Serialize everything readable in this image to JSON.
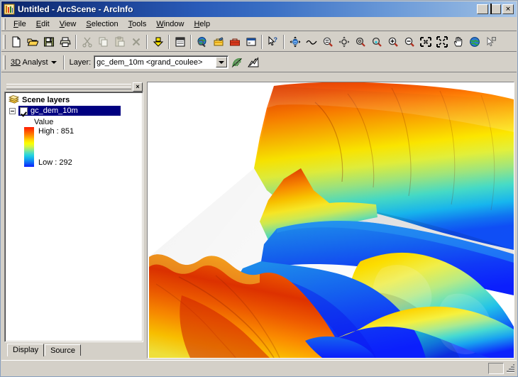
{
  "window": {
    "title": "Untitled - ArcScene - ArcInfo",
    "icon": "arcscene-icon",
    "minimize_label": "_",
    "maximize_label": "□",
    "close_label": "X"
  },
  "menubar": {
    "items": [
      {
        "label": "File",
        "accel": "F"
      },
      {
        "label": "Edit",
        "accel": "E"
      },
      {
        "label": "View",
        "accel": "V"
      },
      {
        "label": "Selection",
        "accel": "S"
      },
      {
        "label": "Tools",
        "accel": "T"
      },
      {
        "label": "Window",
        "accel": "W"
      },
      {
        "label": "Help",
        "accel": "H"
      }
    ]
  },
  "toolbar_standard": {
    "buttons": [
      {
        "name": "new-document-button",
        "icon": "new-document-icon",
        "enabled": true
      },
      {
        "name": "open-button",
        "icon": "open-folder-icon",
        "enabled": true
      },
      {
        "name": "save-button",
        "icon": "save-disk-icon",
        "enabled": true
      },
      {
        "name": "print-button",
        "icon": "printer-icon",
        "enabled": true
      },
      {
        "name": "cut-button",
        "icon": "scissors-icon",
        "enabled": false
      },
      {
        "name": "copy-button",
        "icon": "copy-icon",
        "enabled": false
      },
      {
        "name": "paste-button",
        "icon": "clipboard-icon",
        "enabled": false
      },
      {
        "name": "delete-button",
        "icon": "delete-x-icon",
        "enabled": false
      },
      {
        "name": "add-data-button",
        "icon": "add-data-icon",
        "enabled": true
      },
      {
        "name": "toc-toggle-button",
        "icon": "table-of-contents-icon",
        "enabled": true
      },
      {
        "name": "arctoolbox-button",
        "icon": "globe-magnifier-icon",
        "enabled": true
      },
      {
        "name": "show-toolbox-button",
        "icon": "toolbox-icon",
        "enabled": true
      },
      {
        "name": "model-builder-button",
        "icon": "red-toolbox-icon",
        "enabled": true
      },
      {
        "name": "command-line-button",
        "icon": "command-window-icon",
        "enabled": true
      },
      {
        "name": "whats-this-button",
        "icon": "arrow-question-icon",
        "enabled": true
      },
      {
        "name": "navigate-button",
        "icon": "navigate-globe-icon",
        "enabled": true
      },
      {
        "name": "fly-button",
        "icon": "fly-path-icon",
        "enabled": true
      },
      {
        "name": "zoom-in-out-button",
        "icon": "zoom-in-out-icon",
        "enabled": true
      },
      {
        "name": "center-on-target-button",
        "icon": "center-target-icon",
        "enabled": true
      },
      {
        "name": "zoom-to-target-button",
        "icon": "zoom-target-icon",
        "enabled": true
      },
      {
        "name": "set-observer-button",
        "icon": "set-observer-icon",
        "enabled": true
      },
      {
        "name": "zoom-in-button",
        "icon": "zoom-in-icon",
        "enabled": true
      },
      {
        "name": "zoom-out-button",
        "icon": "zoom-out-icon",
        "enabled": true
      },
      {
        "name": "zoom-to-selection-button",
        "icon": "zoom-selection-icon",
        "enabled": true
      },
      {
        "name": "full-extent-button",
        "icon": "full-extent-icon",
        "enabled": true
      },
      {
        "name": "pan-button",
        "icon": "hand-pan-icon",
        "enabled": true
      },
      {
        "name": "full-extent-globe-button",
        "icon": "globe-extent-icon",
        "enabled": true
      },
      {
        "name": "select-features-button",
        "icon": "select-arrow-icon",
        "enabled": true
      }
    ]
  },
  "toolbar_3d_analyst": {
    "menu_label": "3D Analyst",
    "menu_accel": "D",
    "layer_label": "Layer:",
    "layer_value": "gc_dem_10m <grand_coulee>",
    "layer_options": [
      "gc_dem_10m <grand_coulee>"
    ],
    "buttons": [
      {
        "name": "contour-tool-button",
        "icon": "contour-icon"
      },
      {
        "name": "line-of-sight-tool-button",
        "icon": "line-of-sight-icon"
      }
    ]
  },
  "toc": {
    "panel_title": "Scene layers",
    "panel_icon": "layers-stack-icon",
    "close_label": "×",
    "layer": {
      "name": "gc_dem_10m",
      "checked": true,
      "expanded": true,
      "renderer_field": "Value",
      "high_label": "High : 851",
      "low_label": "Low : 292",
      "high_value": 851,
      "low_value": 292
    },
    "tabs": [
      {
        "label": "Display",
        "active": true
      },
      {
        "label": "Source",
        "active": false
      }
    ]
  },
  "scene": {
    "name": "3d-scene-view",
    "background": "#ffffff",
    "description": "3D perspective surface rendering of gc_dem_10m digital elevation model of the Grand Coulee, colored by elevation"
  },
  "statusbar": {
    "text": ""
  },
  "colors": {
    "titlebar_start": "#0a246a",
    "titlebar_end": "#a8c6e8",
    "chrome": "#d4d0c8",
    "selection": "#000080",
    "ramp_high": "#ff1a00",
    "ramp_low": "#0b1ffd"
  }
}
